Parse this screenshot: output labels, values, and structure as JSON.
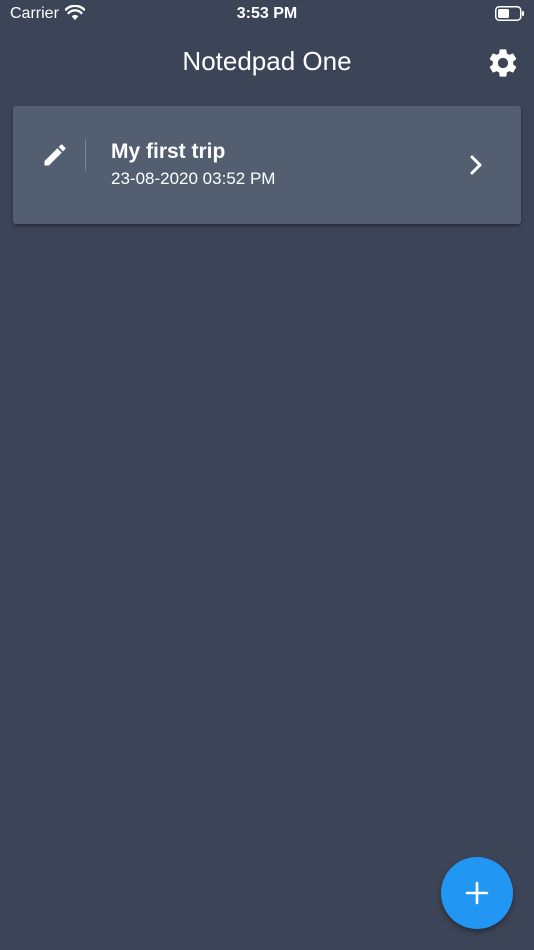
{
  "status_bar": {
    "carrier": "Carrier",
    "time": "3:53 PM",
    "icons": [
      "wifi-icon",
      "battery-icon"
    ]
  },
  "header": {
    "title": "Notedpad One",
    "settings_icon": "gear-icon"
  },
  "notes": [
    {
      "title": "My first trip",
      "date": "23-08-2020 03:52 PM",
      "leading_icon": "pencil-icon",
      "trailing_icon": "chevron-right-icon"
    }
  ],
  "fab": {
    "icon": "plus-icon",
    "color": "#2196f3"
  },
  "colors": {
    "background": "#3c4457",
    "card": "#535e70",
    "accent": "#2196f3",
    "text": "#ffffff"
  }
}
